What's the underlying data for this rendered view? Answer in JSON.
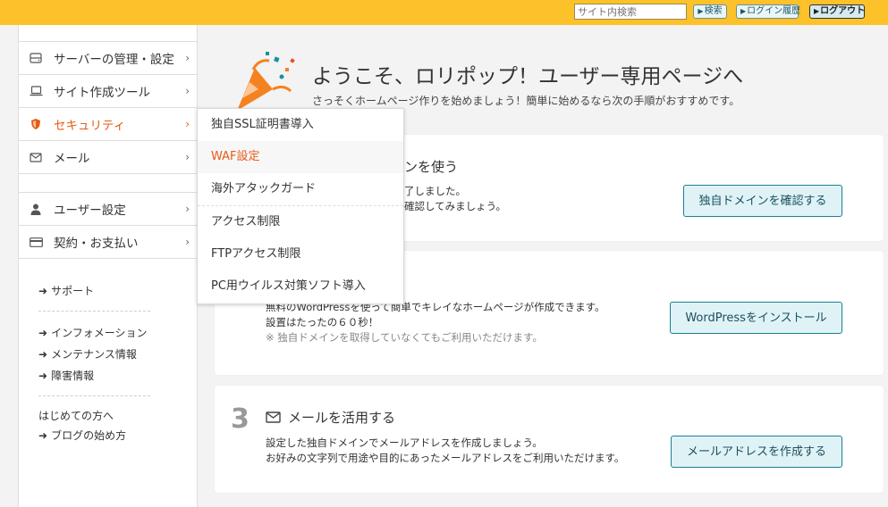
{
  "header": {
    "search_placeholder": "サイト内検索",
    "search_button": "検索",
    "login_history_button": "ログイン履歴",
    "logout_button": "ログアウト"
  },
  "sidebar": {
    "main_items": [
      {
        "label": "サーバーの管理・設定",
        "icon": "server-icon"
      },
      {
        "label": "サイト作成ツール",
        "icon": "laptop-icon"
      },
      {
        "label": "セキュリティ",
        "icon": "shield-icon",
        "active": true
      },
      {
        "label": "メール",
        "icon": "mail-icon"
      }
    ],
    "account_items": [
      {
        "label": "ユーザー設定",
        "icon": "user-icon"
      },
      {
        "label": "契約・お支払い",
        "icon": "credit-card-icon"
      }
    ],
    "links": {
      "support": "サポート",
      "information": "インフォメーション",
      "maintenance": "メンテナンス情報",
      "failure": "障害情報",
      "beginners_label": "はじめての方へ",
      "blog_start": "ブログの始め方"
    }
  },
  "security_menu": {
    "items": [
      "独自SSL証明書導入",
      "WAF設定",
      "海外アタックガード",
      "アクセス制限",
      "FTPアクセス制限",
      "PC用ウイルス対策ソフト導入"
    ],
    "highlighted": "WAF設定"
  },
  "welcome": {
    "title": "ようこそ、ロリポップ！ユーザー専用ページへ",
    "subtitle": "さっそくホームページ作りを始めましょう！簡単に始めるなら次の手順がおすすめです。"
  },
  "steps": [
    {
      "title_visible": "ンを使う",
      "desc_line1_visible": "了しました。",
      "desc_line2_visible": "確認してみましょう。",
      "button": "独自ドメインを確認する"
    },
    {
      "desc_line1": "無料のWordPressを使って簡単でキレイなホームページが作成できます。",
      "desc_line2": "設置はたったの６０秒！",
      "note": "※ 独自ドメインを取得していなくてもご利用いただけます。",
      "button": "WordPressをインストール"
    },
    {
      "number": "3",
      "title": "メールを活用する",
      "icon": "mail-icon",
      "desc_line1": "設定した独自ドメインでメールアドレスを作成しましょう。",
      "desc_line2": "お好みの文字列で用途や目的にあったメールアドレスをご利用いただけます。",
      "button": "メールアドレスを作成する"
    }
  ],
  "colors": {
    "header_bg": "#fdc12a",
    "accent_orange": "#e65c16",
    "button_border": "#1c7f94",
    "button_bg": "#dff3f7"
  }
}
